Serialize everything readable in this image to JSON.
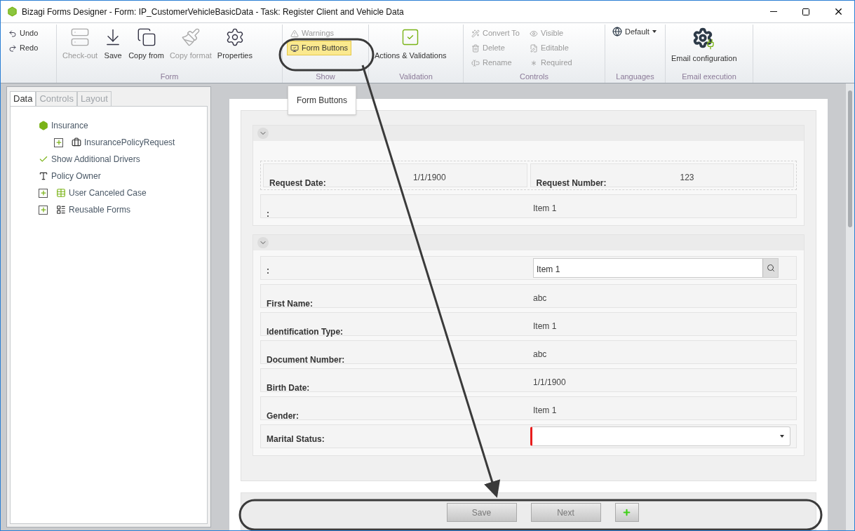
{
  "window": {
    "title": "Bizagi Forms Designer  - Form: IP_CustomerVehicleBasicData - Task:  Register Client and Vehicle Data"
  },
  "ribbon": {
    "groups": [
      {
        "items": [
          {
            "kind": "small",
            "label": "Undo",
            "disabled": false
          },
          {
            "kind": "small",
            "label": "Redo",
            "disabled": false
          }
        ]
      },
      {
        "label": "Form",
        "items": [
          {
            "kind": "large",
            "label": "Check-out",
            "disabled": true
          },
          {
            "kind": "large",
            "label": "Save",
            "disabled": false
          },
          {
            "kind": "large",
            "label": "Copy from",
            "disabled": false
          },
          {
            "kind": "large",
            "label": "Copy format",
            "disabled": true
          },
          {
            "kind": "large",
            "label": "Properties",
            "disabled": false
          }
        ]
      },
      {
        "label": "Show",
        "items": [
          {
            "kind": "small",
            "label": "Warnings",
            "disabled": true,
            "selected": false
          },
          {
            "kind": "small",
            "label": "Form Buttons",
            "disabled": false,
            "selected": true
          }
        ]
      },
      {
        "label": "Validation",
        "items": [
          {
            "kind": "large",
            "label": "Actions & Validations",
            "disabled": false
          }
        ]
      },
      {
        "label": "Controls",
        "items": [
          {
            "kind": "small",
            "label": "Convert To",
            "disabled": true
          },
          {
            "kind": "small",
            "label": "Delete",
            "disabled": true
          },
          {
            "kind": "small",
            "label": "Rename",
            "disabled": true
          },
          {
            "kind": "small",
            "label": "Visible",
            "disabled": true
          },
          {
            "kind": "small",
            "label": "Editable",
            "disabled": true
          },
          {
            "kind": "small",
            "label": "Required",
            "disabled": true
          }
        ]
      },
      {
        "label": "Languages",
        "items": [
          {
            "kind": "dropdown",
            "label": "Default",
            "disabled": false
          }
        ]
      },
      {
        "label": "Email execution",
        "items": [
          {
            "kind": "large",
            "label": "Email configuration",
            "disabled": false
          }
        ]
      }
    ]
  },
  "tooltip": "Form Buttons",
  "left_panel": {
    "tabs": [
      {
        "label": "Data",
        "selected": true
      },
      {
        "label": "Controls",
        "selected": false
      },
      {
        "label": "Layout",
        "selected": false
      }
    ],
    "tree": [
      {
        "label": "Insurance",
        "kind": "entity",
        "expandable": false,
        "children": [
          {
            "label": "InsurancePolicyRequest",
            "kind": "relation",
            "expandable": true
          }
        ]
      },
      {
        "label": "Show Additional Drivers",
        "kind": "boolean",
        "expandable": false
      },
      {
        "label": "Policy Owner",
        "kind": "text",
        "expandable": false
      },
      {
        "label": "User Canceled Case",
        "kind": "table",
        "expandable": true
      },
      {
        "label": "Reusable Forms",
        "kind": "forms",
        "expandable": true
      }
    ]
  },
  "form": {
    "sections": [
      {
        "rows": [
          {
            "kind": "pair",
            "fields": [
              {
                "label": "Request Date:",
                "value": "1/1/1900"
              },
              {
                "label": "Request Number:",
                "value": "123"
              }
            ]
          },
          {
            "kind": "text",
            "label": ":",
            "value": "Item 1"
          }
        ]
      },
      {
        "rows": [
          {
            "kind": "search",
            "label": ":",
            "value": "Item 1"
          },
          {
            "kind": "text",
            "label": "First Name:",
            "value": "abc"
          },
          {
            "kind": "text",
            "label": "Identification Type:",
            "value": "Item 1"
          },
          {
            "kind": "text",
            "label": "Document Number:",
            "value": "abc"
          },
          {
            "kind": "text",
            "label": "Birth Date:",
            "value": "1/1/1900"
          },
          {
            "kind": "text",
            "label": "Gender:",
            "value": "Item 1"
          },
          {
            "kind": "combo",
            "label": "Marital Status:",
            "required": true
          }
        ]
      }
    ]
  },
  "form_buttons": [
    {
      "kind": "text",
      "label": "Save"
    },
    {
      "kind": "text",
      "label": "Next"
    },
    {
      "kind": "add"
    }
  ]
}
